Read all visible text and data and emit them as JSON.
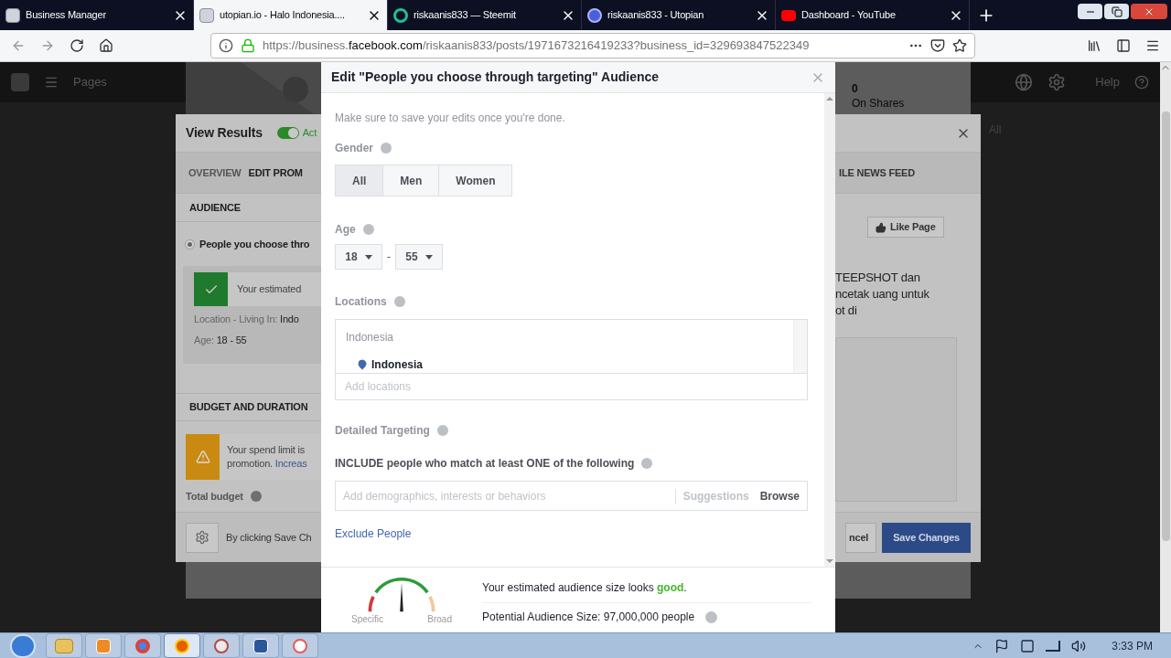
{
  "browser": {
    "tabs": [
      {
        "title": "Business Manager",
        "kind": "page",
        "selected": false
      },
      {
        "title": "utopian.io - Halo Indonesia....",
        "kind": "page",
        "selected": true
      },
      {
        "title": "riskaanis833 — Steemit",
        "kind": "steemit",
        "selected": false
      },
      {
        "title": "riskaanis833 - Utopian",
        "kind": "utopian",
        "selected": false
      },
      {
        "title": "Dashboard - YouTube",
        "kind": "youtube",
        "selected": false
      }
    ],
    "url": {
      "scheme": "https://business.",
      "domain": "facebook.com",
      "path": "/riskaanis833/posts/1971673216419233?business_id=329693847522349"
    }
  },
  "page_header": {
    "pages_label": "Pages",
    "help_label": "Help"
  },
  "post_stats": {
    "count": "0",
    "label": "On Shares"
  },
  "background_dialog": {
    "title": "View Results",
    "toggle": {
      "on": true,
      "label": "Act"
    },
    "side_label": "All",
    "tabs": [
      {
        "label": "OVERVIEW",
        "selected": false
      },
      {
        "label": "EDIT PROM",
        "selected": true
      },
      {
        "label": "ILE NEWS FEED",
        "selected": false
      }
    ],
    "audience_header": "AUDIENCE",
    "audience_option": {
      "label": "People you choose thro",
      "selected": true
    },
    "estimate_text": "Your estimated",
    "location_key": "Location - Living In: ",
    "location_value": "Indo",
    "age_key": "Age: ",
    "age_value": "18 - 55",
    "budget_header": "BUDGET AND DURATION",
    "warning_lines": [
      "Your spend limit is",
      "promotion. "
    ],
    "warning_link": "Increas",
    "total_budget": "Total budget",
    "footer_text": "By clicking Save Ch",
    "cancel": "ncel",
    "save": "Save Changes",
    "preview": {
      "like": "Like Page",
      "lines": [
        "TEEPSHOT dan",
        "ncetak uang untuk",
        "ot di"
      ]
    }
  },
  "modal": {
    "title": "Edit \"People you choose through targeting\" Audience",
    "hint": "Make sure to save your edits once you're done.",
    "gender_label": "Gender",
    "genders": [
      {
        "label": "All",
        "selected": true
      },
      {
        "label": "Men",
        "selected": false
      },
      {
        "label": "Women",
        "selected": false
      }
    ],
    "age_label": "Age",
    "age_min": "18",
    "age_separator": "-",
    "age_max": "55",
    "locations_label": "Locations",
    "location_group": "Indonesia",
    "location_item": "Indonesia",
    "locations_placeholder": "Add locations",
    "targeting_label": "Detailed Targeting",
    "include_text": "INCLUDE people who match at least ONE of the following",
    "targeting_placeholder": "Add demographics, interests or behaviors",
    "suggestions": "Suggestions",
    "browse": "Browse",
    "exclude": "Exclude People",
    "gauge": {
      "low": "Specific",
      "high": "Broad"
    },
    "estimate": "Your estimated audience size looks **good**.",
    "potential": "Potential Audience Size: 97,000,000 people"
  },
  "taskbar": {
    "apps": [
      {
        "kind": "folder",
        "selected": false
      },
      {
        "kind": "media",
        "selected": false
      },
      {
        "kind": "chrome",
        "selected": false
      },
      {
        "kind": "firefox",
        "selected": true
      },
      {
        "kind": "paint",
        "selected": false
      },
      {
        "kind": "word",
        "selected": false
      },
      {
        "kind": "recorder",
        "selected": false
      }
    ],
    "time": "3:33 PM"
  }
}
